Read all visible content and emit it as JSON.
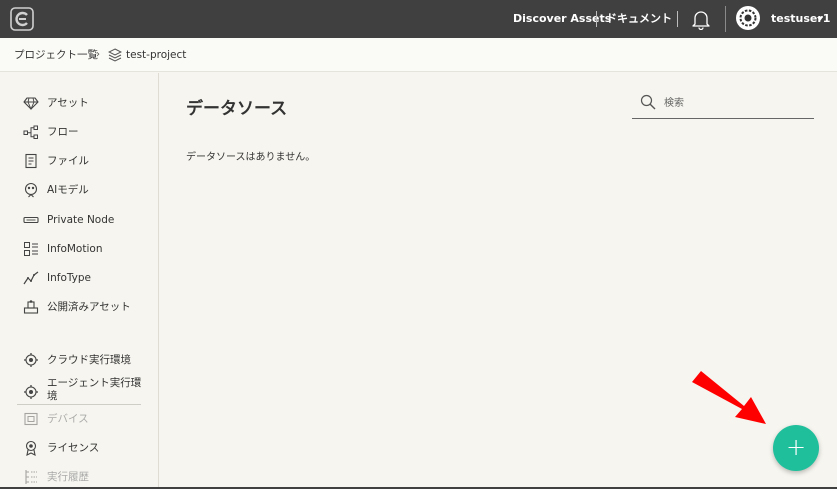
{
  "header": {
    "discover_label": "Discover Assets",
    "docs_label": "ドキュメント",
    "username": "testuser1"
  },
  "breadcrumb": {
    "root": "プロジェクト一覧",
    "separator": "›",
    "project": "test-project"
  },
  "sidebar": {
    "items": [
      {
        "label": "アセット",
        "icon": "diamond-icon"
      },
      {
        "label": "フロー",
        "icon": "flow-icon"
      },
      {
        "label": "ファイル",
        "icon": "file-icon"
      },
      {
        "label": "AIモデル",
        "icon": "ai-model-icon"
      },
      {
        "label": "Private Node",
        "icon": "node-icon"
      },
      {
        "label": "InfoMotion",
        "icon": "infomotion-icon"
      },
      {
        "label": "InfoType",
        "icon": "infotype-icon"
      },
      {
        "label": "公開済みアセット",
        "icon": "published-assets-icon"
      }
    ],
    "items2": [
      {
        "label": "クラウド実行環境",
        "icon": "cloud-runtime-icon",
        "disabled": false
      },
      {
        "label": "エージェント実行環境",
        "icon": "agent-runtime-icon",
        "disabled": false
      },
      {
        "label": "デバイス",
        "icon": "device-icon",
        "disabled": true
      },
      {
        "label": "ライセンス",
        "icon": "license-icon",
        "disabled": false
      },
      {
        "label": "実行履歴",
        "icon": "history-icon",
        "disabled": true
      }
    ]
  },
  "main": {
    "title": "データソース",
    "search_placeholder": "検索",
    "empty_message": "データソースはありません。",
    "fab_label": "+"
  },
  "colors": {
    "topbar": "#404040",
    "fab": "#1fbf9c",
    "arrow": "#ff0000"
  }
}
